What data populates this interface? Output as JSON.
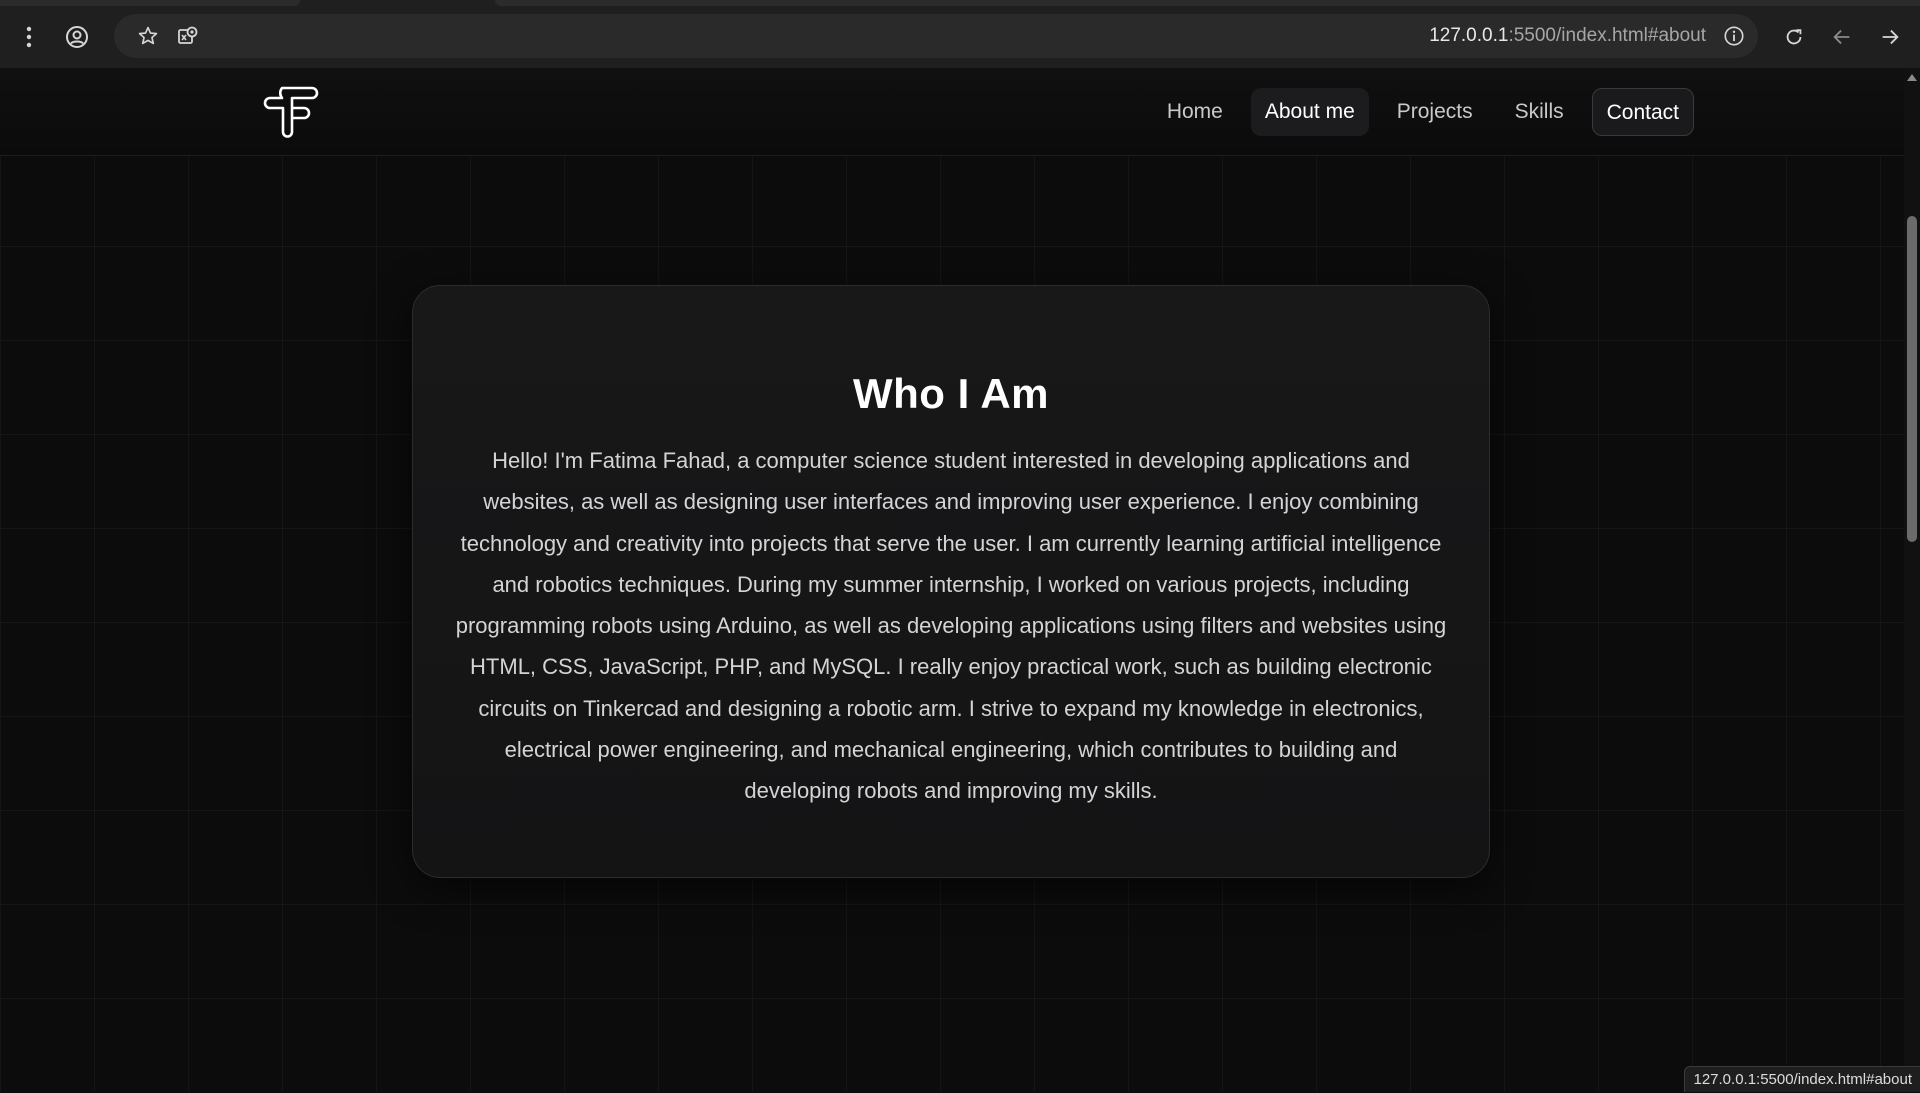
{
  "browser": {
    "url_host": "127.0.0.1",
    "url_rest": ":5500/index.html#about",
    "status_link": "127.0.0.1:5500/index.html#about",
    "icons": [
      "menu-dots-icon",
      "profile-icon",
      "bookmark-star-icon",
      "extension-icon",
      "site-info-icon",
      "reload-icon",
      "back-icon",
      "forward-icon"
    ]
  },
  "nav": {
    "items": [
      {
        "label": "Home"
      },
      {
        "label": "About me"
      },
      {
        "label": "Projects"
      },
      {
        "label": "Skills"
      },
      {
        "label": "Contact"
      }
    ],
    "active": "About me"
  },
  "about": {
    "title": "Who I Am",
    "body": "Hello! I'm Fatima Fahad, a computer science student interested in developing applications and websites, as well as designing user interfaces and improving user experience. I enjoy combining technology and creativity into projects that serve the user. I am currently learning artificial intelligence and robotics techniques. During my summer internship, I worked on various projects, including programming robots using Arduino, as well as developing applications using filters and websites using HTML, CSS, JavaScript, PHP, and MySQL. I really enjoy practical work, such as building electronic circuits on Tinkercad and designing a robotic arm. I strive to expand my knowledge in electronics, electrical power engineering, and mechanical engineering, which contributes to building and developing robots and improving my skills."
  },
  "colors": {
    "page_bg": "#0c0c0d",
    "card_bg": "#161617",
    "text_primary": "#ffffff",
    "text_body": "#d4d4d4",
    "chrome_bg": "#1f1f20"
  }
}
